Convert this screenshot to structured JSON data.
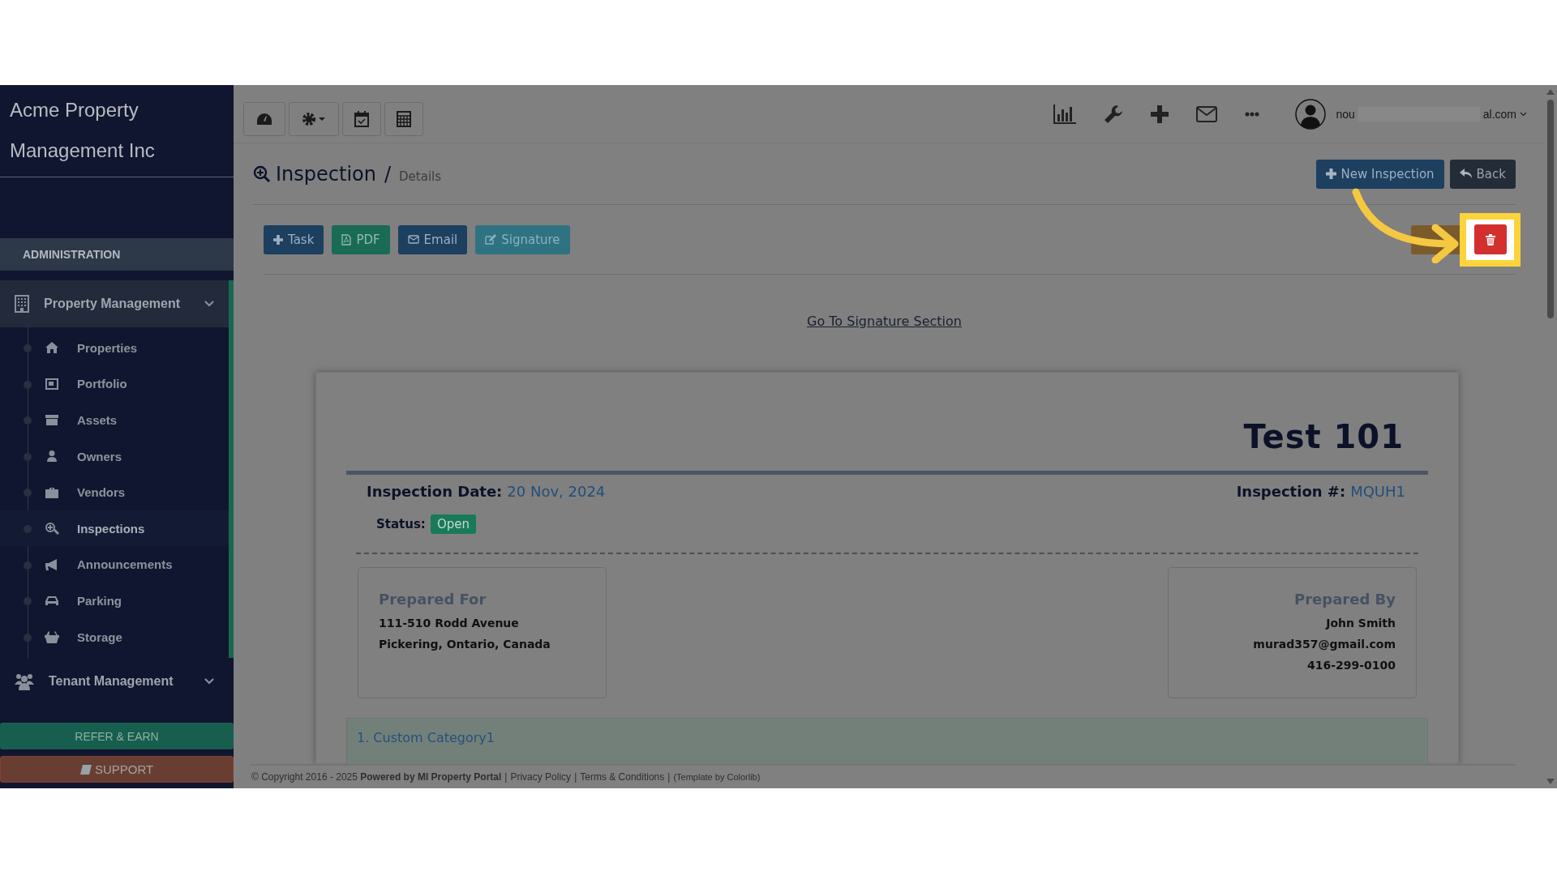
{
  "sidebar": {
    "brand_lines": [
      "Acme Property",
      "Management Inc"
    ],
    "section": "ADMINISTRATION",
    "groups": [
      {
        "label": "Property Management",
        "active": true,
        "children": [
          {
            "label": "Properties",
            "selected": false
          },
          {
            "label": "Portfolio",
            "selected": false
          },
          {
            "label": "Assets",
            "selected": false
          },
          {
            "label": "Owners",
            "selected": false
          },
          {
            "label": "Vendors",
            "selected": false
          },
          {
            "label": "Inspections",
            "selected": true
          },
          {
            "label": "Announcements",
            "selected": false
          },
          {
            "label": "Parking",
            "selected": false
          },
          {
            "label": "Storage",
            "selected": false
          }
        ]
      },
      {
        "label": "Tenant Management",
        "active": false
      }
    ],
    "refer": "REFER & EARN",
    "support": "SUPPORT"
  },
  "topbar": {
    "user": {
      "email_start": "nou",
      "email_end": "al.com"
    }
  },
  "page": {
    "title": "Inspection",
    "separator": "/",
    "subtitle": "Details",
    "header_buttons": [
      {
        "label": "New Inspection",
        "kind": "primary"
      },
      {
        "label": "Back",
        "kind": "dark"
      }
    ],
    "actions": [
      {
        "label": "Task",
        "kind": "primary"
      },
      {
        "label": "PDF",
        "kind": "success"
      },
      {
        "label": "Email",
        "kind": "primary"
      },
      {
        "label": "Signature",
        "kind": "info"
      }
    ],
    "signature_link": "Go To Signature Section"
  },
  "document": {
    "title": "Test 101",
    "date_label": "Inspection Date:",
    "date": "20 Nov, 2024",
    "number_label": "Inspection #:",
    "number": "MQUH1",
    "status_label": "Status:",
    "status": "Open",
    "prepared_for": {
      "heading": "Prepared For",
      "lines": [
        "111-510 Rodd Avenue",
        "Pickering, Ontario, Canada"
      ]
    },
    "prepared_by": {
      "heading": "Prepared By",
      "lines": [
        "John Smith",
        "murad357@gmail.com",
        "416-299-0100"
      ]
    },
    "categories": [
      "1. Custom Category1"
    ]
  },
  "footer": {
    "copyright": "© Copyright 2016 - 2025 **Powered by MI Property Portal**",
    "separator": "|",
    "links": [
      "Privacy Policy",
      "Terms & Conditions"
    ],
    "credit": "(Template by Colorlib)"
  }
}
